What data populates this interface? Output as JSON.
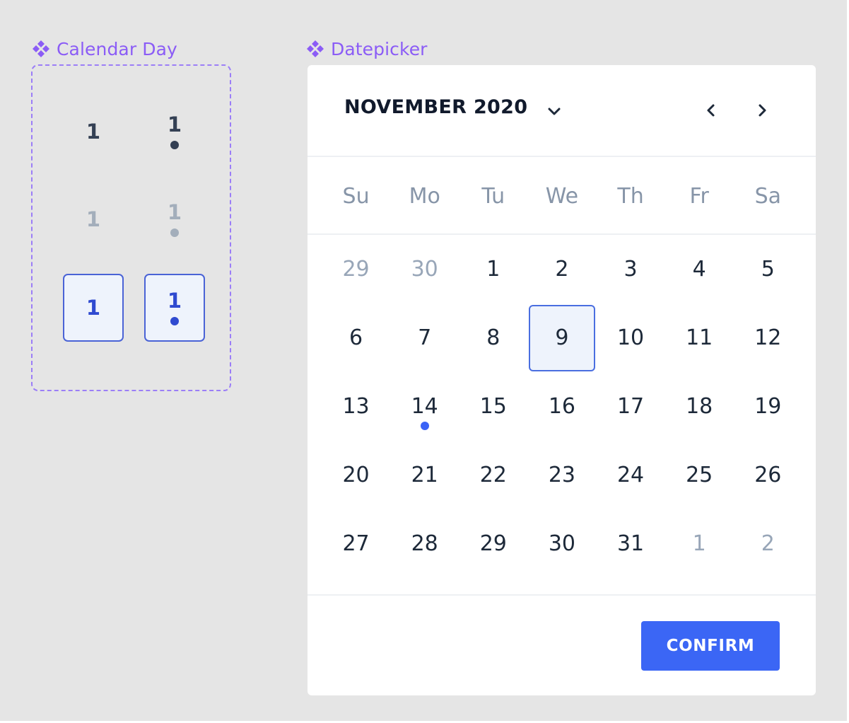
{
  "labels": {
    "calendar_day": "Calendar Day",
    "datepicker": "Datepicker"
  },
  "calendar_day_variants": [
    {
      "day": "1",
      "state": "default",
      "has_event": false
    },
    {
      "day": "1",
      "state": "default",
      "has_event": true
    },
    {
      "day": "1",
      "state": "outside-month",
      "has_event": false
    },
    {
      "day": "1",
      "state": "outside-month",
      "has_event": true
    },
    {
      "day": "1",
      "state": "selected",
      "has_event": false
    },
    {
      "day": "1",
      "state": "selected",
      "has_event": true
    }
  ],
  "datepicker": {
    "month_title": "NOVEMBER 2020",
    "weekdays": [
      "Su",
      "Mo",
      "Tu",
      "We",
      "Th",
      "Fr",
      "Sa"
    ],
    "days": [
      {
        "label": "29",
        "outside": true
      },
      {
        "label": "30",
        "outside": true
      },
      {
        "label": "1"
      },
      {
        "label": "2"
      },
      {
        "label": "3"
      },
      {
        "label": "4"
      },
      {
        "label": "5"
      },
      {
        "label": "6"
      },
      {
        "label": "7"
      },
      {
        "label": "8"
      },
      {
        "label": "9",
        "selected": true
      },
      {
        "label": "10"
      },
      {
        "label": "11"
      },
      {
        "label": "12"
      },
      {
        "label": "13"
      },
      {
        "label": "14",
        "event": true
      },
      {
        "label": "15"
      },
      {
        "label": "16"
      },
      {
        "label": "17"
      },
      {
        "label": "18"
      },
      {
        "label": "19"
      },
      {
        "label": "20"
      },
      {
        "label": "21"
      },
      {
        "label": "22"
      },
      {
        "label": "23"
      },
      {
        "label": "24"
      },
      {
        "label": "25"
      },
      {
        "label": "26"
      },
      {
        "label": "27"
      },
      {
        "label": "28"
      },
      {
        "label": "29"
      },
      {
        "label": "30"
      },
      {
        "label": "31"
      },
      {
        "label": "1",
        "outside": true
      },
      {
        "label": "2",
        "outside": true
      }
    ],
    "confirm_label": "CONFIRM"
  },
  "icons": {
    "component": "diamond-icon",
    "dropdown": "chevron-down-icon",
    "prev": "chevron-left-icon",
    "next": "chevron-right-icon"
  },
  "colors": {
    "background": "#e5e5e5",
    "component_label": "#8b5cf6",
    "accent": "#3b66f5",
    "selected_fill": "#eef3fc",
    "text_primary": "#1d2939",
    "text_muted": "#98a6b8"
  }
}
